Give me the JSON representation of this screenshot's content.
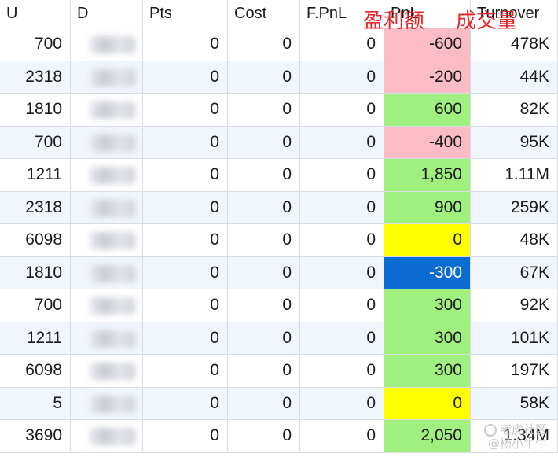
{
  "columns": {
    "u": "U",
    "d": "D",
    "pts": "Pts",
    "cost": "Cost",
    "fpnl": "F.PnL",
    "pnl": "PnL",
    "turnover": "Turnover"
  },
  "annotations": {
    "pnl_cn": "盈利额",
    "turnover_cn": "成交量"
  },
  "rows": [
    {
      "u": "700",
      "pts": "0",
      "cost": "0",
      "fpnl": "0",
      "pnl": "-600",
      "pnl_status": "loss",
      "turnover": "478K"
    },
    {
      "u": "2318",
      "pts": "0",
      "cost": "0",
      "fpnl": "0",
      "pnl": "-200",
      "pnl_status": "loss",
      "turnover": "44K"
    },
    {
      "u": "1810",
      "pts": "0",
      "cost": "0",
      "fpnl": "0",
      "pnl": "600",
      "pnl_status": "gain",
      "turnover": "82K"
    },
    {
      "u": "700",
      "pts": "0",
      "cost": "0",
      "fpnl": "0",
      "pnl": "-400",
      "pnl_status": "loss",
      "turnover": "95K"
    },
    {
      "u": "1211",
      "pts": "0",
      "cost": "0",
      "fpnl": "0",
      "pnl": "1,850",
      "pnl_status": "gain",
      "turnover": "1.11M"
    },
    {
      "u": "2318",
      "pts": "0",
      "cost": "0",
      "fpnl": "0",
      "pnl": "900",
      "pnl_status": "gain",
      "turnover": "259K"
    },
    {
      "u": "6098",
      "pts": "0",
      "cost": "0",
      "fpnl": "0",
      "pnl": "0",
      "pnl_status": "flat",
      "turnover": "48K"
    },
    {
      "u": "1810",
      "pts": "0",
      "cost": "0",
      "fpnl": "0",
      "pnl": "-300",
      "pnl_status": "selected",
      "turnover": "67K"
    },
    {
      "u": "700",
      "pts": "0",
      "cost": "0",
      "fpnl": "0",
      "pnl": "300",
      "pnl_status": "gain",
      "turnover": "92K"
    },
    {
      "u": "1211",
      "pts": "0",
      "cost": "0",
      "fpnl": "0",
      "pnl": "300",
      "pnl_status": "gain",
      "turnover": "101K"
    },
    {
      "u": "6098",
      "pts": "0",
      "cost": "0",
      "fpnl": "0",
      "pnl": "300",
      "pnl_status": "gain",
      "turnover": "197K"
    },
    {
      "u": "5",
      "pts": "0",
      "cost": "0",
      "fpnl": "0",
      "pnl": "0",
      "pnl_status": "flat",
      "turnover": "58K"
    },
    {
      "u": "3690",
      "pts": "0",
      "cost": "0",
      "fpnl": "0",
      "pnl": "2,050",
      "pnl_status": "gain",
      "turnover": "1.34M"
    }
  ],
  "colors": {
    "loss": "#fbbcc6",
    "gain": "#9ff07f",
    "flat": "#ffff00",
    "selected": "#0a6bd1",
    "annotation": "#e8262a"
  },
  "watermark": {
    "line1": "老虎社区",
    "line2": "@杨小牛牛"
  }
}
